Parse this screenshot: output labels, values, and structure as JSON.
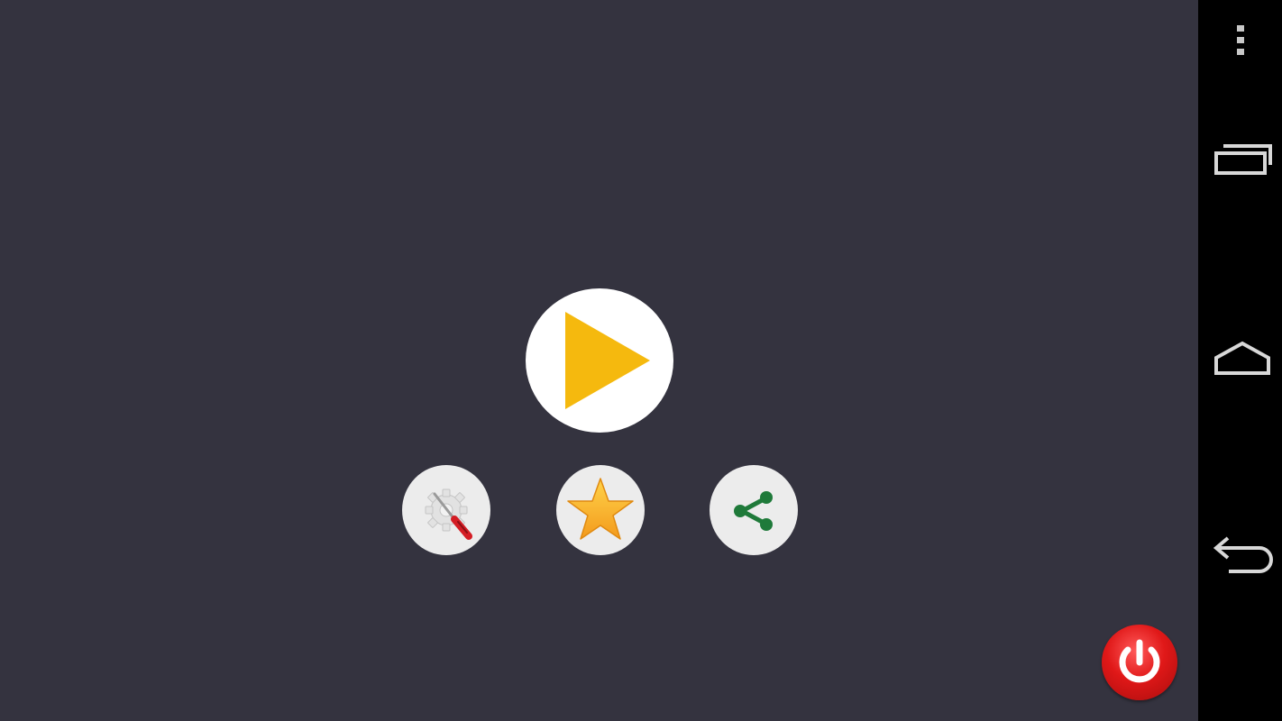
{
  "app": {
    "background_color": "#34333f",
    "play_button": {
      "icon": "play-icon",
      "color": "#f5b90e"
    },
    "settings_button": {
      "icon": "settings-tools-icon"
    },
    "rate_button": {
      "icon": "star-icon",
      "color": "#f6a623"
    },
    "share_button": {
      "icon": "share-icon",
      "color": "#1f7a3a"
    },
    "power_button": {
      "icon": "power-icon",
      "color": "#e01818"
    }
  },
  "navigation_bar": {
    "background_color": "#000000",
    "items": [
      {
        "icon": "overflow-menu-icon"
      },
      {
        "icon": "recent-apps-icon"
      },
      {
        "icon": "home-icon"
      },
      {
        "icon": "back-icon"
      }
    ]
  }
}
